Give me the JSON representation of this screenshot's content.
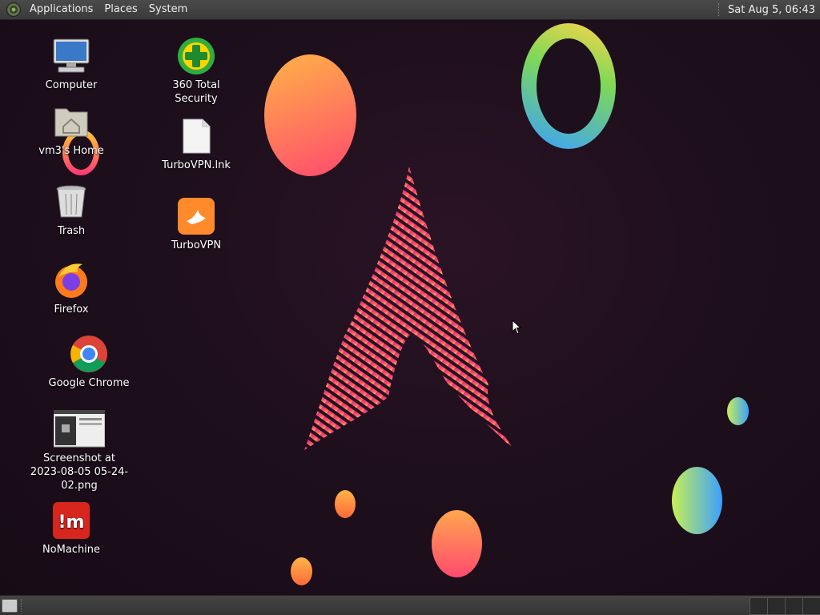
{
  "topbar": {
    "menus": [
      "Applications",
      "Places",
      "System"
    ],
    "clock": "Sat Aug  5, 06:43"
  },
  "desktop_icons": [
    {
      "label": "Computer",
      "icon": "computer-icon"
    },
    {
      "label": "vm3's Home",
      "icon": "home-folder-icon"
    },
    {
      "label": "Trash",
      "icon": "trash-icon"
    },
    {
      "label": "Firefox",
      "icon": "firefox-icon"
    },
    {
      "label": "Google Chrome",
      "icon": "chrome-icon"
    },
    {
      "label": "Screenshot at 2023-08-05 05-24-02.png",
      "icon": "image-thumbnail-icon"
    },
    {
      "label": "NoMachine",
      "icon": "nomachine-icon"
    },
    {
      "label": "360 Total Security",
      "icon": "360-security-icon"
    },
    {
      "label": "TurboVPN.lnk",
      "icon": "file-icon"
    },
    {
      "label": "TurboVPN",
      "icon": "turbovpn-icon"
    }
  ],
  "colors": {
    "background": "#1e0f1c",
    "panel": "#3c3c3c",
    "accent_pink": "#e0307a",
    "accent_orange": "#ff9a3c"
  }
}
